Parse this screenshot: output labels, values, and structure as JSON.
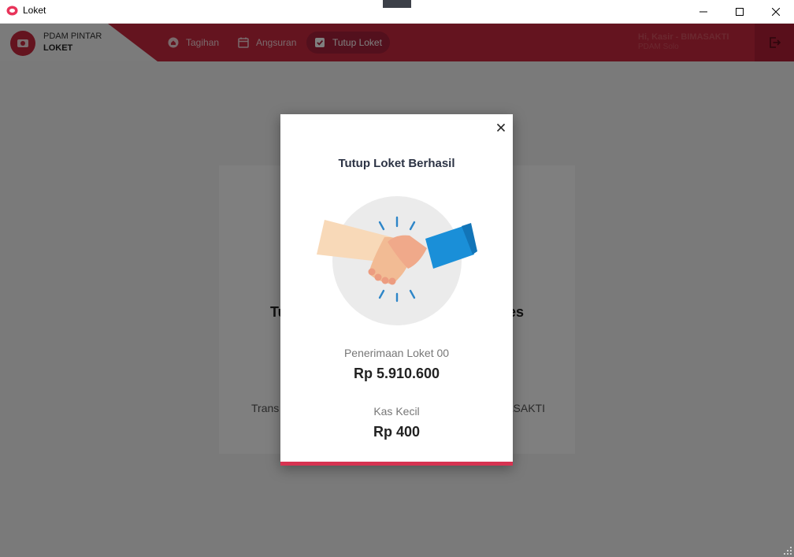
{
  "window": {
    "title": "Loket"
  },
  "header": {
    "brand_line1": "PDAM PINTAR",
    "brand_line2": "LOKET",
    "nav": [
      {
        "label": "Tagihan",
        "icon": "home-icon",
        "active": false
      },
      {
        "label": "Angsuran",
        "icon": "calendar-icon",
        "active": false
      },
      {
        "label": "Tutup Loket",
        "icon": "checkbox-icon",
        "active": true
      }
    ],
    "user_greeting": "Hi, Kasir - BIMASAKTI",
    "user_org": "PDAM Solo"
  },
  "background": {
    "heading_left": "Tu",
    "heading_right": "es",
    "sub_left": "Trans",
    "sub_right": "MASAKTI"
  },
  "modal": {
    "title": "Tutup Loket Berhasil",
    "penerimaan_label": "Penerimaan Loket 00",
    "penerimaan_value": "Rp 5.910.600",
    "kas_kecil_label": "Kas Kecil",
    "kas_kecil_value": "Rp 400"
  },
  "colors": {
    "accent": "#c8283f",
    "accent_bar": "#d63351",
    "sleeve": "#1a8fd8"
  }
}
